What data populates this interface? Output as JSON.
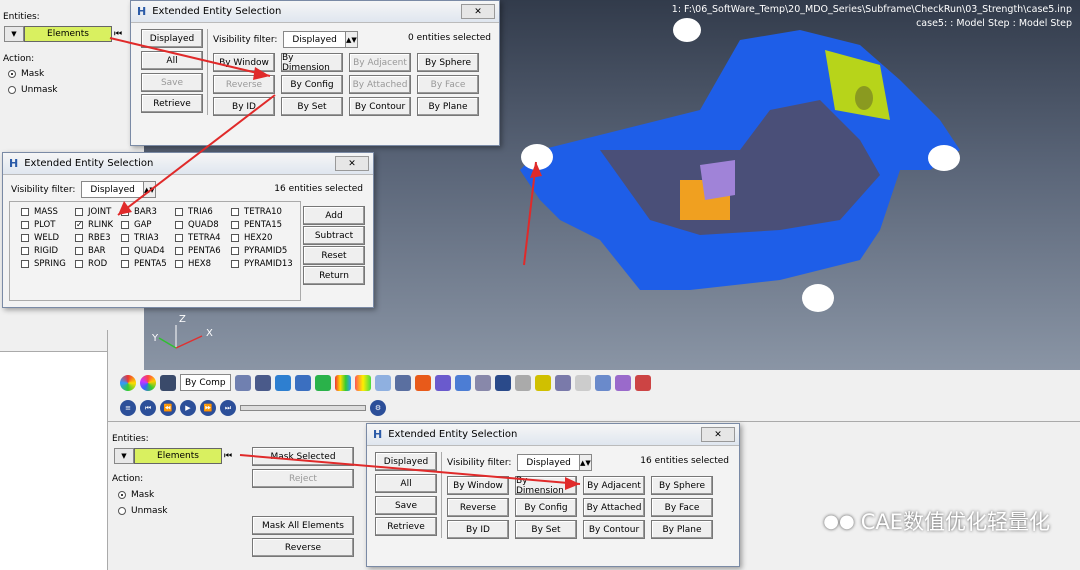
{
  "viewport": {
    "path_line1": "1: F:\\06_SoftWare_Temp\\20_MDO_Series\\Subframe\\CheckRun\\03_Strength\\case5.inp",
    "path_line2": "case5: : Model Step : Model Step",
    "axes": {
      "y": "Y",
      "z": "Z",
      "x": "X"
    }
  },
  "top_panel": {
    "entities_label": "Entities:",
    "entity_type": "Elements",
    "action_label": "Action:",
    "mask": "Mask",
    "unmask": "Unmask"
  },
  "dialog1": {
    "title": "Extended Entity Selection",
    "close": "",
    "displayed": "Displayed",
    "all": "All",
    "save": "Save",
    "retrieve": "Retrieve",
    "visibility_label": "Visibility filter:",
    "visibility_value": "Displayed",
    "count": "0 entities selected",
    "buttons": [
      "By Window",
      "By Dimension",
      "By Adjacent",
      "By Sphere",
      "Reverse",
      "By Config",
      "By Attached",
      "By Face",
      "By ID",
      "By Set",
      "By Contour",
      "By Plane"
    ]
  },
  "dialog2": {
    "title": "Extended Entity Selection",
    "close": "",
    "visibility_label": "Visibility filter:",
    "visibility_value": "Displayed",
    "count": "16 entities selected",
    "col1": [
      "MASS",
      "PLOT",
      "WELD",
      "RIGID",
      "SPRING"
    ],
    "col2": [
      "JOINT",
      "RLINK",
      "RBE3",
      "BAR",
      "ROD"
    ],
    "col3": [
      "BAR3",
      "GAP",
      "TRIA3",
      "QUAD4",
      "PENTA5"
    ],
    "col4": [
      "TRIA6",
      "QUAD8",
      "TETRA4",
      "PENTA6",
      "HEX8"
    ],
    "col5": [
      "TETRA10",
      "PENTA15",
      "HEX20",
      "PYRAMID5",
      "PYRAMID13"
    ],
    "checked": "RLINK",
    "add": "Add",
    "subtract": "Subtract",
    "reset": "Reset",
    "return": "Return"
  },
  "toolbar": {
    "bycomp": "By Comp"
  },
  "lower_panel": {
    "entities_label": "Entities:",
    "entity_type": "Elements",
    "action_label": "Action:",
    "mask": "Mask",
    "unmask": "Unmask",
    "mask_selected": "Mask Selected",
    "reject": "Reject",
    "mask_all": "Mask All Elements",
    "reverse": "Reverse"
  },
  "dialog3": {
    "title": "Extended Entity Selection",
    "displayed": "Displayed",
    "all": "All",
    "save": "Save",
    "retrieve": "Retrieve",
    "visibility_label": "Visibility filter:",
    "visibility_value": "Displayed",
    "count": "16 entities selected",
    "buttons": [
      "By Window",
      "By Dimension",
      "By Adjacent",
      "By Sphere",
      "Reverse",
      "By Config",
      "By Attached",
      "By Face",
      "By ID",
      "By Set",
      "By Contour",
      "By Plane"
    ]
  },
  "watermark": "CAE数值优化轻量化",
  "colors": {
    "mesh": "#1e5ee8",
    "accent_yellow": "#b7d41a",
    "accent_orange": "#f0a020",
    "arrow": "#e02a2a"
  }
}
